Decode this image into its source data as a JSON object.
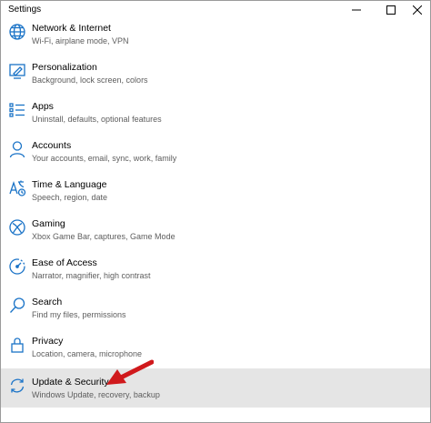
{
  "window": {
    "title": "Settings"
  },
  "items": [
    {
      "label": "Network & Internet",
      "desc": "Wi-Fi, airplane mode, VPN",
      "icon": "globe-icon"
    },
    {
      "label": "Personalization",
      "desc": "Background, lock screen, colors",
      "icon": "personalization-icon"
    },
    {
      "label": "Apps",
      "desc": "Uninstall, defaults, optional features",
      "icon": "apps-list-icon"
    },
    {
      "label": "Accounts",
      "desc": "Your accounts, email, sync, work, family",
      "icon": "person-icon"
    },
    {
      "label": "Time & Language",
      "desc": "Speech, region, date",
      "icon": "time-language-icon"
    },
    {
      "label": "Gaming",
      "desc": "Xbox Game Bar, captures, Game Mode",
      "icon": "xbox-icon"
    },
    {
      "label": "Ease of Access",
      "desc": "Narrator, magnifier, high contrast",
      "icon": "ease-of-access-icon"
    },
    {
      "label": "Search",
      "desc": "Find my files, permissions",
      "icon": "search-icon"
    },
    {
      "label": "Privacy",
      "desc": "Location, camera, microphone",
      "icon": "lock-icon"
    },
    {
      "label": "Update & Security",
      "desc": "Windows Update, recovery, backup",
      "icon": "sync-icon"
    }
  ],
  "selected_index": 9,
  "colors": {
    "icon": "#1a73c7",
    "arrow": "#d0191c",
    "selected_bg": "#e5e5e5"
  }
}
